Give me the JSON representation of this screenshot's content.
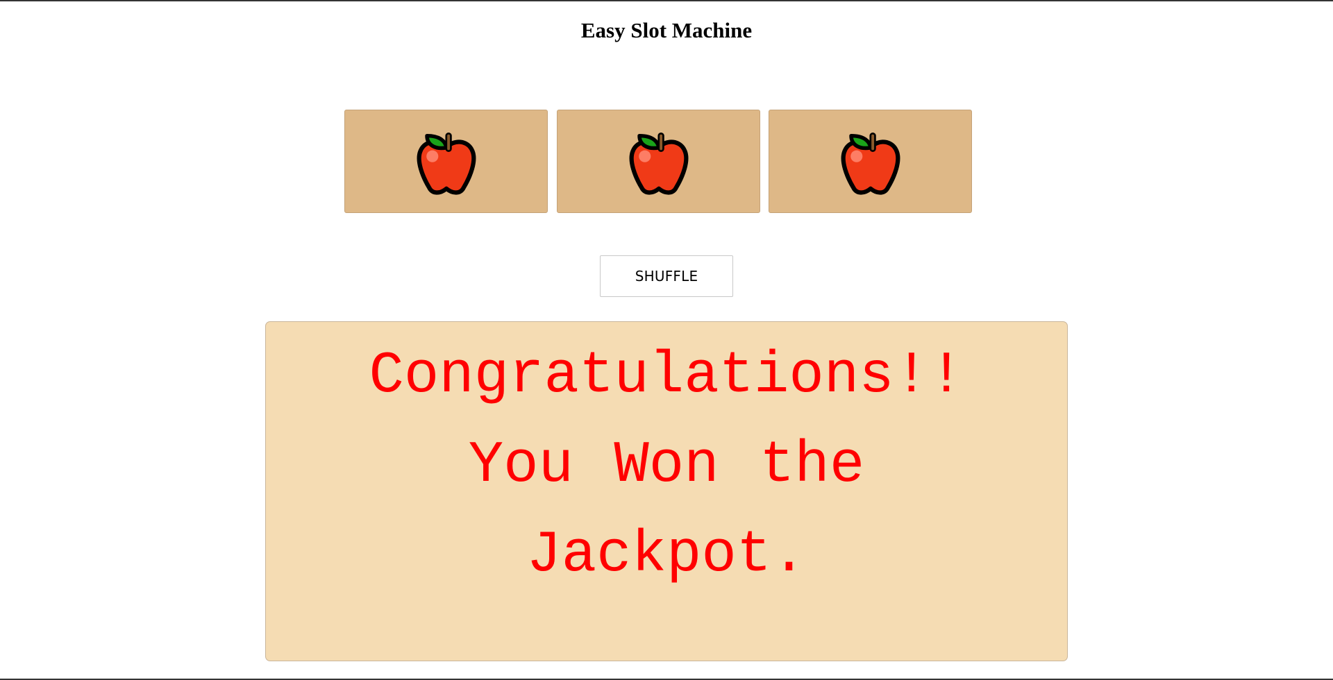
{
  "app": {
    "title": "Easy Slot Machine"
  },
  "reels": [
    {
      "symbol": "apple-icon"
    },
    {
      "symbol": "apple-icon"
    },
    {
      "symbol": "apple-icon"
    }
  ],
  "controls": {
    "shuffle_label": "SHUFFLE"
  },
  "result": {
    "lines": [
      "Congratulations!!",
      "You Won the",
      "Jackpot."
    ],
    "color": "#ff0000",
    "background": "#f5dcb3"
  },
  "colors": {
    "reel_background": "#deb887",
    "apple_red": "#f03a17",
    "leaf_green": "#1aa31a"
  }
}
